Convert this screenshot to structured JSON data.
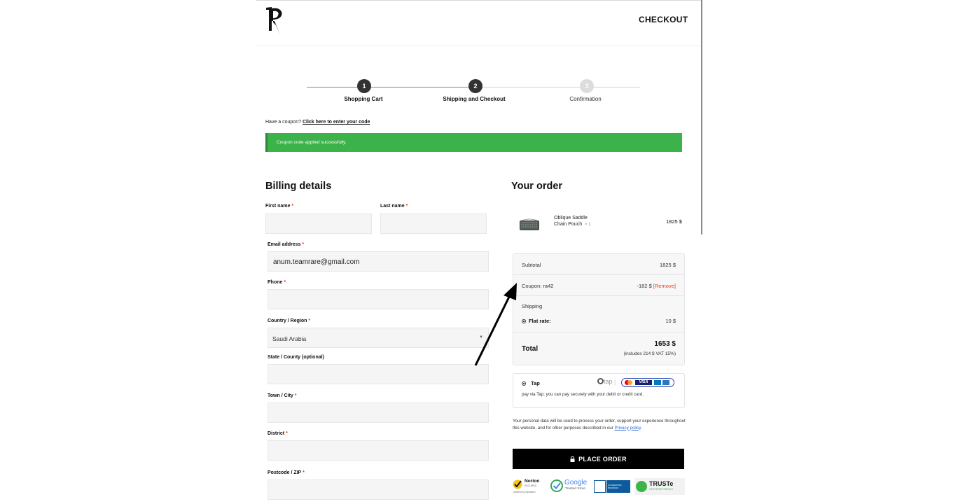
{
  "header": {
    "title": "CHECKOUT"
  },
  "stepper": {
    "steps": [
      {
        "number": "1",
        "label": "Shopping Cart"
      },
      {
        "number": "2",
        "label": "Shipping and Checkout"
      },
      {
        "number": "3",
        "label": "Confirmation"
      }
    ]
  },
  "coupon": {
    "prompt": "Have a coupon?",
    "link": "Click here to enter your code",
    "notice": "Coupon code applied successfully."
  },
  "billing": {
    "title": "Billing details",
    "required_mark": "*",
    "first_name": {
      "label": "First name",
      "value": ""
    },
    "last_name": {
      "label": "Last name",
      "value": ""
    },
    "email": {
      "label": "Email address",
      "value": "anum.teamrare@gmail.com"
    },
    "phone": {
      "label": "Phone",
      "value": ""
    },
    "country": {
      "label": "Country / Region",
      "value": "Saudi Arabia"
    },
    "state": {
      "label": "State / County (optional)",
      "value": ""
    },
    "town": {
      "label": "Town / City",
      "value": ""
    },
    "district": {
      "label": "District",
      "value": ""
    },
    "postcode": {
      "label": "Postcode / ZIP",
      "value": ""
    }
  },
  "order": {
    "title": "Your order",
    "product": {
      "name_line1": "Oblique Saddle",
      "name_line2": "Chain Pouch",
      "qty": "× 1",
      "price": "1825 $"
    },
    "subtotal": {
      "label": "Subtotal",
      "value": "1825 $"
    },
    "coupon": {
      "label": "Coupon: ra42",
      "value": "-182 $",
      "remove": "[Remove]"
    },
    "shipping": {
      "label": "Shipping",
      "method": "Flat rate:",
      "value": "10 $"
    },
    "total": {
      "label": "Total",
      "value": "1653 $",
      "vat_note": "(includes 214 $ VAT 15%)"
    }
  },
  "payment": {
    "method": "Tap",
    "logo_text": "tap",
    "card_text": "VISA",
    "description": "pay via Tap; you can pay securely with your debit or credit card."
  },
  "privacy": {
    "text": "Your personal data will be used to process your order, support your experience throughout this website, and for other purposes described in our",
    "link": "Privacy policy",
    "end": "."
  },
  "place_order": {
    "label": "PLACE ORDER"
  },
  "badges": {
    "norton": "Norton",
    "norton_sub": "SECURED",
    "norton_foot": "powered by Symantec",
    "google": "Google",
    "google_sub": "Trusted Store",
    "bbb": "ACCREDITED BUSINESS",
    "truste": "TRUSTe",
    "truste_sub": "CERTIFIED PRIVACY"
  },
  "colors": {
    "accent_green": "#3cb24a",
    "step_active": "#333333",
    "step_inactive": "#d9d9d9",
    "required": "#e2401c",
    "button": "#000000"
  }
}
